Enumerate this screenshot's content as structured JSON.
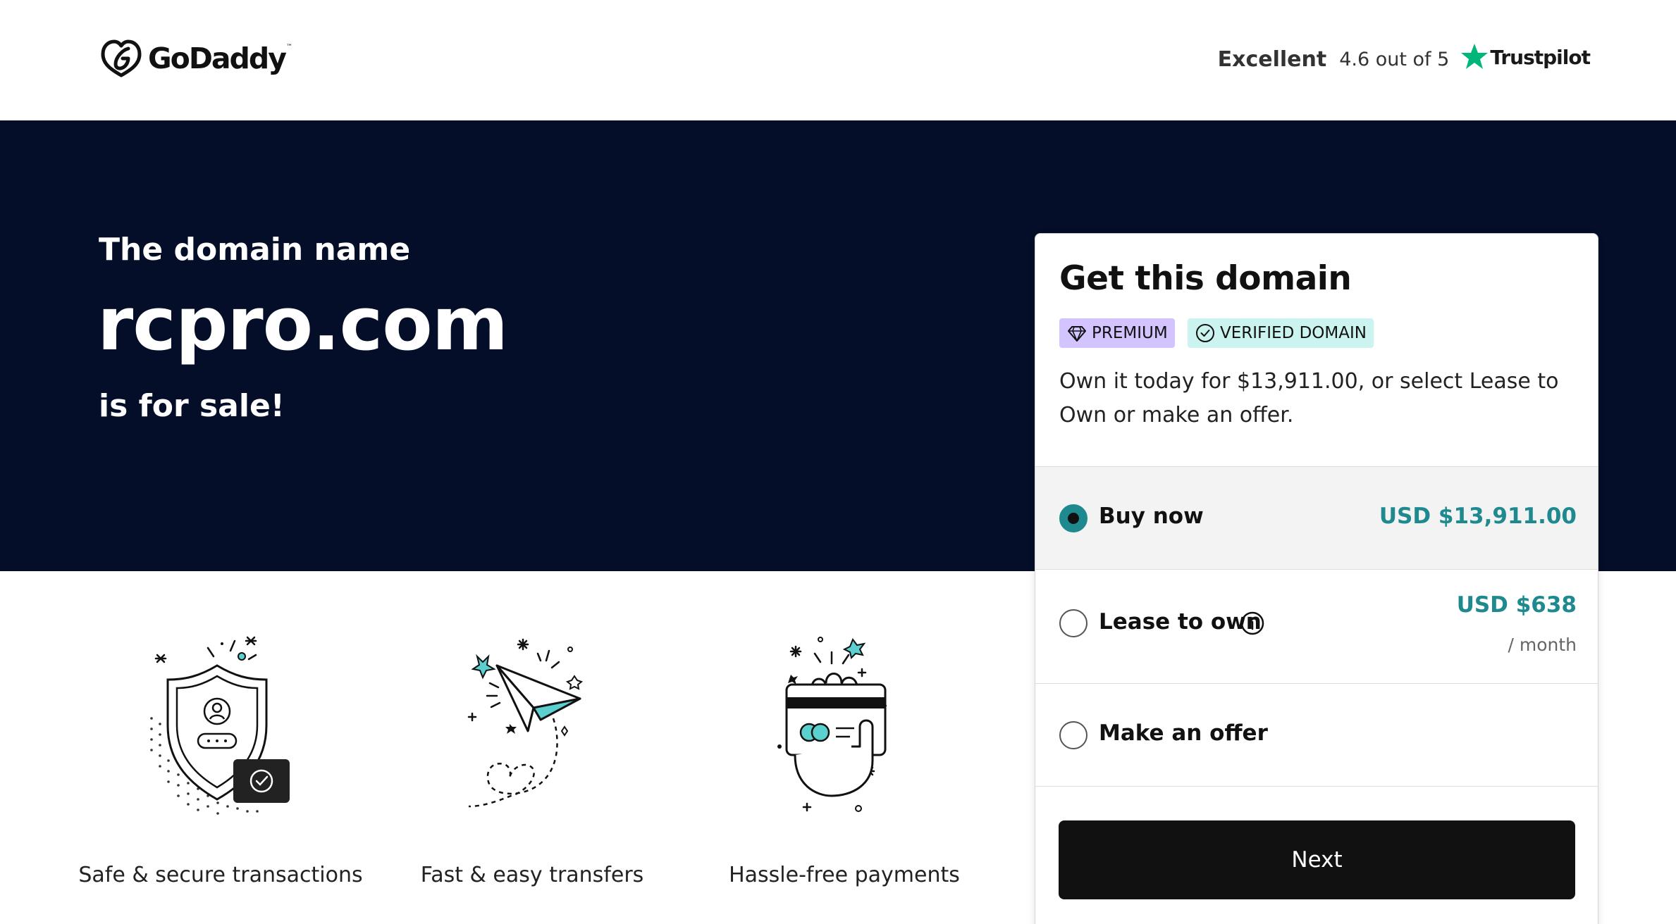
{
  "header": {
    "logo_text": "GoDaddy",
    "logo_tm": "™",
    "trust_rating_word": "Excellent",
    "trust_score": "4.6 out of 5",
    "trust_brand": "Trustpilot"
  },
  "hero": {
    "pre": "The domain name",
    "domain": "rcpro.com",
    "post": "is for sale!"
  },
  "features": [
    {
      "label": "Safe & secure transactions",
      "icon": "shield-check-icon"
    },
    {
      "label": "Fast & easy transfers",
      "icon": "paper-plane-icon"
    },
    {
      "label": "Hassle-free payments",
      "icon": "hand-card-icon"
    }
  ],
  "card": {
    "title": "Get this domain",
    "badges": {
      "premium": "PREMIUM",
      "verified": "VERIFIED DOMAIN"
    },
    "description": "Own it today for $13,911.00, or select Lease to Own or make an offer.",
    "options": {
      "buy": {
        "label": "Buy now",
        "price": "USD  $13,911.00",
        "selected": true
      },
      "lease": {
        "label": "Lease to own",
        "price": "USD  $638",
        "per": "/ month",
        "selected": false
      },
      "offer": {
        "label": "Make an offer",
        "selected": false
      }
    },
    "next_label": "Next"
  },
  "colors": {
    "hero_bg": "#040e28",
    "accent_teal": "#1e8a8f",
    "premium_badge": "#d3c3ff",
    "verified_badge": "#cbf4f0",
    "trustpilot_green": "#00b67a"
  }
}
